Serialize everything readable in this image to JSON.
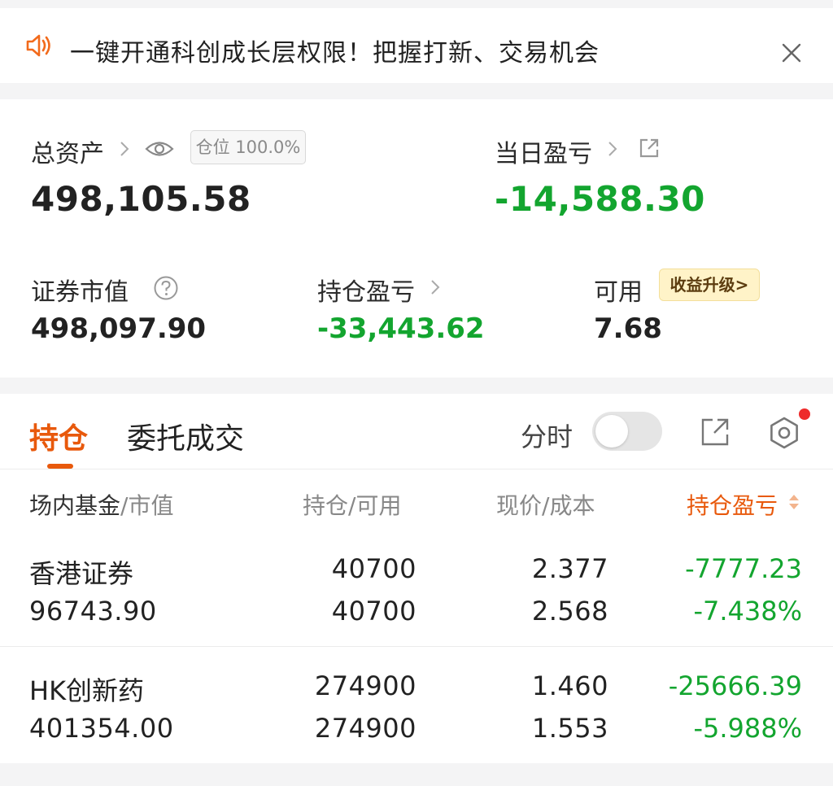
{
  "banner": {
    "text": "一键开通科创成长层权限！把握打新、交易机会",
    "speaker_icon": "speaker-icon",
    "close_icon": "close-icon",
    "accent": "#f26a1b"
  },
  "summary": {
    "total_assets_label": "总资产",
    "total_assets_value": "498,105.58",
    "position_badge": "仓位 100.0%",
    "daily_pnl_label": "当日盈亏",
    "daily_pnl_value": "-14,588.30",
    "market_value_label": "证券市值",
    "market_value": "498,097.90",
    "holding_pnl_label": "持仓盈亏",
    "holding_pnl_value": "-33,443.62",
    "available_label": "可用",
    "available_value": "7.68",
    "upgrade_badge": "收益升级>"
  },
  "tabs": {
    "active": "持仓",
    "other": "委托成交",
    "fenshi_label": "分时",
    "fenshi_on": false
  },
  "table": {
    "headers": {
      "col1_main": "场内基金",
      "col1_sub": "/市值",
      "col2_main": "持仓",
      "col2_sub": "/可用",
      "col3_main": "现价",
      "col3_sub": "/成本",
      "col4_main": "持仓盈亏"
    },
    "rows": [
      {
        "name": "香港证券",
        "market_value": "96743.90",
        "holding": "40700",
        "available": "40700",
        "price": "2.377",
        "cost": "2.568",
        "pnl": "-7777.23",
        "pnl_pct": "-7.438%"
      },
      {
        "name": "HK创新药",
        "market_value": "401354.00",
        "holding": "274900",
        "available": "274900",
        "price": "1.460",
        "cost": "1.553",
        "pnl": "-25666.39",
        "pnl_pct": "-5.988%"
      }
    ]
  },
  "colors": {
    "accent_orange": "#e8590c",
    "loss_green": "#13a52f",
    "notify_red": "#ee2b2b"
  }
}
